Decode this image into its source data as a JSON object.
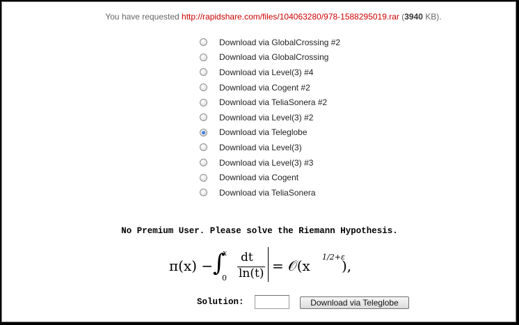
{
  "requested": {
    "prefix": "You have requested",
    "url": "http://rapidshare.com/files/104063280/978-1588295019.rar",
    "size_open": "(",
    "size": "3940",
    "size_unit": "KB).",
    "colors": {
      "url": "#cc0000"
    }
  },
  "mirrors": [
    {
      "label": "Download via GlobalCrossing #2",
      "checked": false
    },
    {
      "label": "Download via GlobalCrossing",
      "checked": false
    },
    {
      "label": "Download via Level(3) #4",
      "checked": false
    },
    {
      "label": "Download via Cogent #2",
      "checked": false
    },
    {
      "label": "Download via TeliaSonera #2",
      "checked": false
    },
    {
      "label": "Download via Level(3) #2",
      "checked": false
    },
    {
      "label": "Download via Teleglobe",
      "checked": true
    },
    {
      "label": "Download via Level(3)",
      "checked": false
    },
    {
      "label": "Download via Level(3) #3",
      "checked": false
    },
    {
      "label": "Download via Cogent",
      "checked": false
    },
    {
      "label": "Download via TeliaSonera",
      "checked": false
    }
  ],
  "notice": "No Premium User. Please solve the Riemann Hypothesis.",
  "formula": {
    "lhs": "π(x) −",
    "integral": "∫",
    "upper": "x",
    "lower": "0",
    "numerator": "dt",
    "denominator": "ln(t)",
    "rhs": "= 𝒪(x",
    "exponent": "1/2+ε",
    "end": "),"
  },
  "solution": {
    "label": "Solution:",
    "value": "",
    "button_label": "Download via Teleglobe"
  }
}
